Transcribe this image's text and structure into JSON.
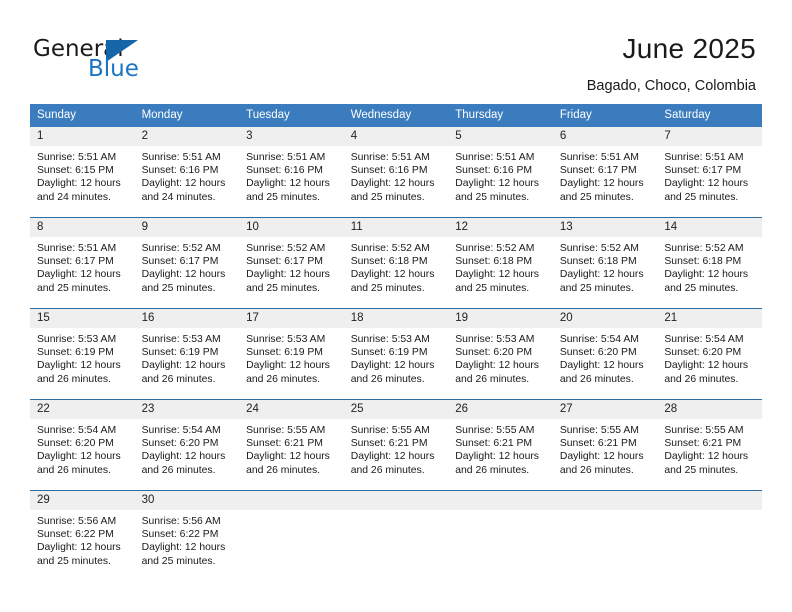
{
  "brand": {
    "name_top": "General",
    "name_bottom": "Blue",
    "accent_color": "#1b74c4",
    "triangle_color": "#1565a8"
  },
  "header": {
    "title": "June 2025",
    "subtitle": "Bagado, Choco, Colombia"
  },
  "calendar": {
    "header_bg": "#3a7cbe",
    "header_text_color": "#ffffff",
    "datenum_bg": "#efefef",
    "week_divider_color": "#2e6da4",
    "weekday_headers": [
      "Sunday",
      "Monday",
      "Tuesday",
      "Wednesday",
      "Thursday",
      "Friday",
      "Saturday"
    ],
    "weeks": [
      [
        {
          "date": "1",
          "sunrise": "Sunrise: 5:51 AM",
          "sunset": "Sunset: 6:15 PM",
          "daylight_line1": "Daylight: 12 hours",
          "daylight_line2": "and 24 minutes."
        },
        {
          "date": "2",
          "sunrise": "Sunrise: 5:51 AM",
          "sunset": "Sunset: 6:16 PM",
          "daylight_line1": "Daylight: 12 hours",
          "daylight_line2": "and 24 minutes."
        },
        {
          "date": "3",
          "sunrise": "Sunrise: 5:51 AM",
          "sunset": "Sunset: 6:16 PM",
          "daylight_line1": "Daylight: 12 hours",
          "daylight_line2": "and 25 minutes."
        },
        {
          "date": "4",
          "sunrise": "Sunrise: 5:51 AM",
          "sunset": "Sunset: 6:16 PM",
          "daylight_line1": "Daylight: 12 hours",
          "daylight_line2": "and 25 minutes."
        },
        {
          "date": "5",
          "sunrise": "Sunrise: 5:51 AM",
          "sunset": "Sunset: 6:16 PM",
          "daylight_line1": "Daylight: 12 hours",
          "daylight_line2": "and 25 minutes."
        },
        {
          "date": "6",
          "sunrise": "Sunrise: 5:51 AM",
          "sunset": "Sunset: 6:17 PM",
          "daylight_line1": "Daylight: 12 hours",
          "daylight_line2": "and 25 minutes."
        },
        {
          "date": "7",
          "sunrise": "Sunrise: 5:51 AM",
          "sunset": "Sunset: 6:17 PM",
          "daylight_line1": "Daylight: 12 hours",
          "daylight_line2": "and 25 minutes."
        }
      ],
      [
        {
          "date": "8",
          "sunrise": "Sunrise: 5:51 AM",
          "sunset": "Sunset: 6:17 PM",
          "daylight_line1": "Daylight: 12 hours",
          "daylight_line2": "and 25 minutes."
        },
        {
          "date": "9",
          "sunrise": "Sunrise: 5:52 AM",
          "sunset": "Sunset: 6:17 PM",
          "daylight_line1": "Daylight: 12 hours",
          "daylight_line2": "and 25 minutes."
        },
        {
          "date": "10",
          "sunrise": "Sunrise: 5:52 AM",
          "sunset": "Sunset: 6:17 PM",
          "daylight_line1": "Daylight: 12 hours",
          "daylight_line2": "and 25 minutes."
        },
        {
          "date": "11",
          "sunrise": "Sunrise: 5:52 AM",
          "sunset": "Sunset: 6:18 PM",
          "daylight_line1": "Daylight: 12 hours",
          "daylight_line2": "and 25 minutes."
        },
        {
          "date": "12",
          "sunrise": "Sunrise: 5:52 AM",
          "sunset": "Sunset: 6:18 PM",
          "daylight_line1": "Daylight: 12 hours",
          "daylight_line2": "and 25 minutes."
        },
        {
          "date": "13",
          "sunrise": "Sunrise: 5:52 AM",
          "sunset": "Sunset: 6:18 PM",
          "daylight_line1": "Daylight: 12 hours",
          "daylight_line2": "and 25 minutes."
        },
        {
          "date": "14",
          "sunrise": "Sunrise: 5:52 AM",
          "sunset": "Sunset: 6:18 PM",
          "daylight_line1": "Daylight: 12 hours",
          "daylight_line2": "and 25 minutes."
        }
      ],
      [
        {
          "date": "15",
          "sunrise": "Sunrise: 5:53 AM",
          "sunset": "Sunset: 6:19 PM",
          "daylight_line1": "Daylight: 12 hours",
          "daylight_line2": "and 26 minutes."
        },
        {
          "date": "16",
          "sunrise": "Sunrise: 5:53 AM",
          "sunset": "Sunset: 6:19 PM",
          "daylight_line1": "Daylight: 12 hours",
          "daylight_line2": "and 26 minutes."
        },
        {
          "date": "17",
          "sunrise": "Sunrise: 5:53 AM",
          "sunset": "Sunset: 6:19 PM",
          "daylight_line1": "Daylight: 12 hours",
          "daylight_line2": "and 26 minutes."
        },
        {
          "date": "18",
          "sunrise": "Sunrise: 5:53 AM",
          "sunset": "Sunset: 6:19 PM",
          "daylight_line1": "Daylight: 12 hours",
          "daylight_line2": "and 26 minutes."
        },
        {
          "date": "19",
          "sunrise": "Sunrise: 5:53 AM",
          "sunset": "Sunset: 6:20 PM",
          "daylight_line1": "Daylight: 12 hours",
          "daylight_line2": "and 26 minutes."
        },
        {
          "date": "20",
          "sunrise": "Sunrise: 5:54 AM",
          "sunset": "Sunset: 6:20 PM",
          "daylight_line1": "Daylight: 12 hours",
          "daylight_line2": "and 26 minutes."
        },
        {
          "date": "21",
          "sunrise": "Sunrise: 5:54 AM",
          "sunset": "Sunset: 6:20 PM",
          "daylight_line1": "Daylight: 12 hours",
          "daylight_line2": "and 26 minutes."
        }
      ],
      [
        {
          "date": "22",
          "sunrise": "Sunrise: 5:54 AM",
          "sunset": "Sunset: 6:20 PM",
          "daylight_line1": "Daylight: 12 hours",
          "daylight_line2": "and 26 minutes."
        },
        {
          "date": "23",
          "sunrise": "Sunrise: 5:54 AM",
          "sunset": "Sunset: 6:20 PM",
          "daylight_line1": "Daylight: 12 hours",
          "daylight_line2": "and 26 minutes."
        },
        {
          "date": "24",
          "sunrise": "Sunrise: 5:55 AM",
          "sunset": "Sunset: 6:21 PM",
          "daylight_line1": "Daylight: 12 hours",
          "daylight_line2": "and 26 minutes."
        },
        {
          "date": "25",
          "sunrise": "Sunrise: 5:55 AM",
          "sunset": "Sunset: 6:21 PM",
          "daylight_line1": "Daylight: 12 hours",
          "daylight_line2": "and 26 minutes."
        },
        {
          "date": "26",
          "sunrise": "Sunrise: 5:55 AM",
          "sunset": "Sunset: 6:21 PM",
          "daylight_line1": "Daylight: 12 hours",
          "daylight_line2": "and 26 minutes."
        },
        {
          "date": "27",
          "sunrise": "Sunrise: 5:55 AM",
          "sunset": "Sunset: 6:21 PM",
          "daylight_line1": "Daylight: 12 hours",
          "daylight_line2": "and 26 minutes."
        },
        {
          "date": "28",
          "sunrise": "Sunrise: 5:55 AM",
          "sunset": "Sunset: 6:21 PM",
          "daylight_line1": "Daylight: 12 hours",
          "daylight_line2": "and 25 minutes."
        }
      ],
      [
        {
          "date": "29",
          "sunrise": "Sunrise: 5:56 AM",
          "sunset": "Sunset: 6:22 PM",
          "daylight_line1": "Daylight: 12 hours",
          "daylight_line2": "and 25 minutes."
        },
        {
          "date": "30",
          "sunrise": "Sunrise: 5:56 AM",
          "sunset": "Sunset: 6:22 PM",
          "daylight_line1": "Daylight: 12 hours",
          "daylight_line2": "and 25 minutes."
        },
        {
          "date": "",
          "sunrise": "",
          "sunset": "",
          "daylight_line1": "",
          "daylight_line2": ""
        },
        {
          "date": "",
          "sunrise": "",
          "sunset": "",
          "daylight_line1": "",
          "daylight_line2": ""
        },
        {
          "date": "",
          "sunrise": "",
          "sunset": "",
          "daylight_line1": "",
          "daylight_line2": ""
        },
        {
          "date": "",
          "sunrise": "",
          "sunset": "",
          "daylight_line1": "",
          "daylight_line2": ""
        },
        {
          "date": "",
          "sunrise": "",
          "sunset": "",
          "daylight_line1": "",
          "daylight_line2": ""
        }
      ]
    ]
  }
}
